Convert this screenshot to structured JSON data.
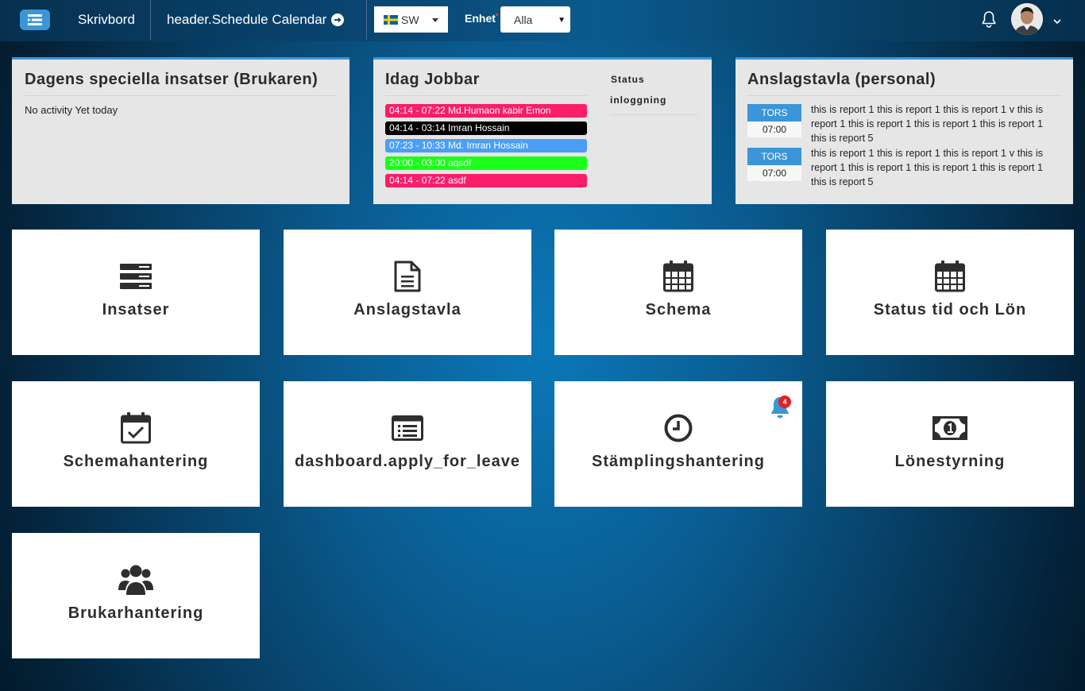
{
  "header": {
    "brand": "Skrivbord",
    "schedule_link": "header.Schedule Calendar",
    "language": "SW",
    "unit_label": "Enhet",
    "unit_required_mark": "*",
    "unit_value": "Alla",
    "unit_arrow": "▼"
  },
  "panels": {
    "special": {
      "title": "Dagens speciella insatser (Brukaren)",
      "empty_text": "No activity Yet today"
    },
    "working_today": {
      "title": "Idag Jobbar",
      "status_header": "Status",
      "status_sub": "inloggning",
      "shifts": [
        {
          "text": "04:14 - 07:22 Md.Humaon kabir Emon",
          "color": "#fa1d6a"
        },
        {
          "text": "04:14 - 03:14 Imran Hossain",
          "color": "#000000"
        },
        {
          "text": "07:23 - 10:33 Md. Imran Hossain",
          "color": "#4a9ff5"
        },
        {
          "text": "20:00 - 03:00 aqsdf",
          "color": "#19ff19"
        },
        {
          "text": "04:14 - 07:22 asdf",
          "color": "#fa1d6a"
        }
      ]
    },
    "notice_board": {
      "title": "Anslagstavla (personal)",
      "items": [
        {
          "day": "TORS",
          "time": "07:00",
          "text": "this is report 1 this is report 1 this is report 1 v this is report 1 this is report 1 this is report 1 this is report 1 this is report 5"
        },
        {
          "day": "TORS",
          "time": "07:00",
          "text": "this is report 1 this is report 1 this is report 1 v this is report 1 this is report 1 this is report 1 this is report 1 this is report 5"
        }
      ]
    }
  },
  "tiles": [
    {
      "label": "Insatser",
      "icon": "server-list-icon"
    },
    {
      "label": "Anslagstavla",
      "icon": "document-icon"
    },
    {
      "label": "Schema",
      "icon": "calendar-icon"
    },
    {
      "label": "Status tid och Lön",
      "icon": "calendar-icon"
    },
    {
      "label": "Schemahantering",
      "icon": "calendar-check-icon"
    },
    {
      "label": "dashboard.apply_for_leave",
      "icon": "list-alt-icon"
    },
    {
      "label": "Stämplingshantering",
      "icon": "clock-icon",
      "badge": "4"
    },
    {
      "label": "Lönestyrning",
      "icon": "money-bill-icon"
    },
    {
      "label": "Brukarhantering",
      "icon": "users-icon"
    }
  ],
  "colors": {
    "accent": "#3b96d8",
    "badge": "#e41e26",
    "tile_text": "#2e2e2e"
  }
}
